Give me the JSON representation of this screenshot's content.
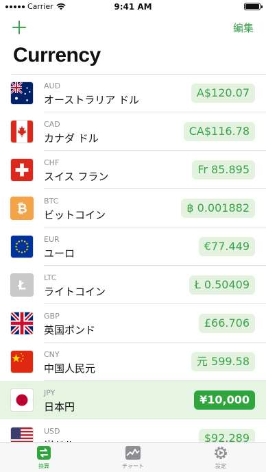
{
  "status_bar": {
    "carrier": "Carrier",
    "time": "9:41 AM"
  },
  "nav": {
    "edit_label": "編集"
  },
  "page": {
    "title": "Currency"
  },
  "currencies": [
    {
      "code": "AUD",
      "name": "オーストラリア ドル",
      "amount": "A$120.07",
      "icon": "australia-flag-icon",
      "selected": false
    },
    {
      "code": "CAD",
      "name": "カナダ ドル",
      "amount": "CA$116.78",
      "icon": "canada-flag-icon",
      "selected": false
    },
    {
      "code": "CHF",
      "name": "スイス フラン",
      "amount": "Fr 85.895",
      "icon": "switzerland-flag-icon",
      "selected": false
    },
    {
      "code": "BTC",
      "name": "ビットコイン",
      "amount": "฿ 0.001882",
      "icon": "bitcoin-icon",
      "selected": false
    },
    {
      "code": "EUR",
      "name": "ユーロ",
      "amount": "€77.449",
      "icon": "eu-flag-icon",
      "selected": false
    },
    {
      "code": "LTC",
      "name": "ライトコイン",
      "amount": "Ł 0.50409",
      "icon": "litecoin-icon",
      "selected": false
    },
    {
      "code": "GBP",
      "name": "英国ポンド",
      "amount": "£66.706",
      "icon": "uk-flag-icon",
      "selected": false
    },
    {
      "code": "CNY",
      "name": "中国人民元",
      "amount": "元 599.58",
      "icon": "china-flag-icon",
      "selected": false
    },
    {
      "code": "JPY",
      "name": "日本円",
      "amount": "¥10,000",
      "icon": "japan-flag-icon",
      "selected": true
    },
    {
      "code": "USD",
      "name": "米ドル",
      "amount": "$92.289",
      "icon": "usa-flag-icon",
      "selected": false
    }
  ],
  "tabs": [
    {
      "label": "換算",
      "icon": "exchange-icon",
      "active": true
    },
    {
      "label": "チャート",
      "icon": "chart-icon",
      "active": false
    },
    {
      "label": "設定",
      "icon": "gear-icon",
      "active": false
    }
  ],
  "colors": {
    "accent": "#3aa34a",
    "accent_dark": "#2fa53d",
    "selected_row": "#e6f5e2",
    "pill": "#e3f3df"
  }
}
